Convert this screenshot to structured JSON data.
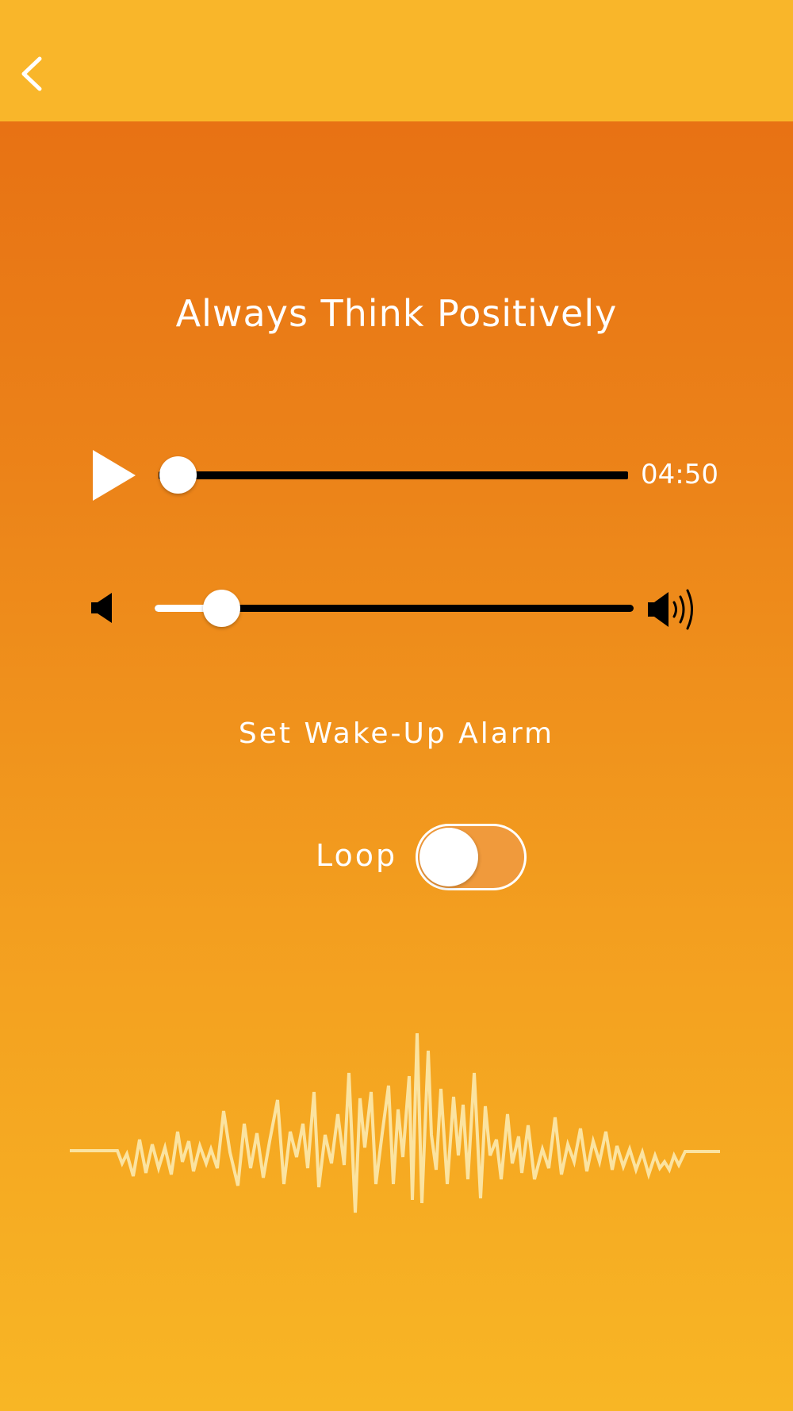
{
  "header": {
    "back_icon": "chevron-left-icon",
    "background": "#F9B62A"
  },
  "player": {
    "title": "Always Think Positively",
    "play_icon": "play-icon",
    "progress_fraction": 0.0,
    "time_remaining": "04:50",
    "volume_fraction": 0.05,
    "volume_low_icon": "speaker-mute-icon",
    "volume_high_icon": "speaker-loud-icon"
  },
  "alarm": {
    "label": "Set Wake-Up Alarm"
  },
  "loop": {
    "label": "Loop",
    "enabled": false
  },
  "waveform": {
    "icon": "audio-waveform-graphic",
    "color": "#FBE3A0"
  },
  "colors": {
    "gradient_top": "#E66C12",
    "gradient_bottom": "#F8B625",
    "text": "#FFFFFF",
    "track": "#000000"
  }
}
